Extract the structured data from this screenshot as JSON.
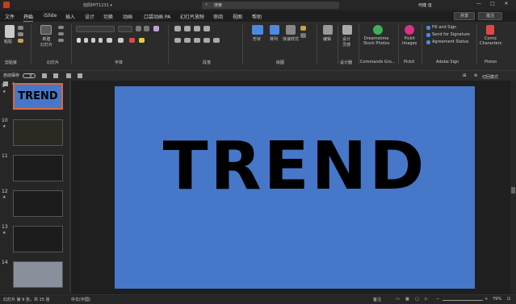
{
  "titlebar": {
    "title": "旭阳PPT1231 ▾",
    "search": "搜索",
    "user": "何婕 谊",
    "minimize": "—",
    "restore": "□",
    "close": "✕"
  },
  "tabs": [
    "文件",
    "开始",
    "iSlide",
    "插入",
    "设计",
    "切换",
    "动画",
    "口袋动画 PA",
    "幻灯片放映",
    "审阅",
    "视图",
    "帮助"
  ],
  "share": "共享",
  "comment": "批注",
  "ribbon": {
    "clipboard": {
      "paste": "粘贴",
      "group": "剪贴板"
    },
    "slides": {
      "new": "新建\n幻灯片",
      "group": "幻灯片"
    },
    "font": {
      "group": "字体"
    },
    "paragraph": {
      "group": "段落"
    },
    "drawing": {
      "shape": "形状",
      "arrange": "排列",
      "quickstyle": "快速样式",
      "group": "绘图"
    },
    "editing": {
      "label": "编辑"
    },
    "designer": {
      "label": "设计\n灵感",
      "group": "设计器"
    },
    "dreamstime": {
      "label": "Dreamstime\nStock Photos",
      "group": "Commands Gro..."
    },
    "pickit": {
      "label": "Pickit\nImages",
      "group": "Pickit"
    },
    "adobe": {
      "fill": "Fill and Sign",
      "send": "Send for Signature",
      "status": "Agreement Status",
      "group": "Adobe Sign"
    },
    "pixton": {
      "label": "Comic\nCharacters",
      "group": "Pixton"
    }
  },
  "qat": {
    "autosave": "自动保存",
    "toggle": "关"
  },
  "toolbar2": {
    "view": "切回模式"
  },
  "slides": [
    {
      "num": "9",
      "star": true
    },
    {
      "num": "10",
      "star": true
    },
    {
      "num": "11",
      "star": false
    },
    {
      "num": "12",
      "star": true
    },
    {
      "num": "13",
      "star": true
    },
    {
      "num": "14",
      "star": false
    }
  ],
  "thumb9_text": "TREND",
  "slide": {
    "text": "TREND",
    "bg": "#4677c8"
  },
  "status": {
    "slide": "幻灯片 第 9 张，共 15 张",
    "lang": "中文(中国)",
    "notes": "备注",
    "zoom": "79%"
  }
}
